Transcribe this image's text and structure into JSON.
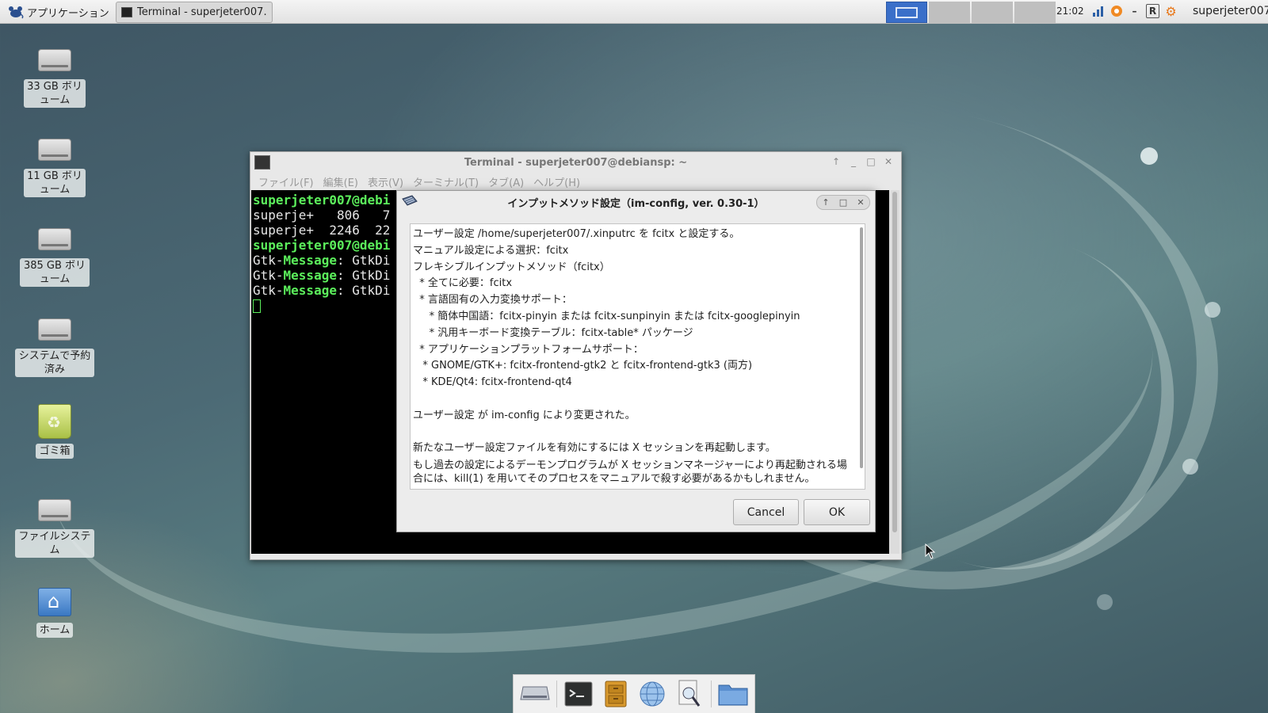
{
  "panel": {
    "apps_menu_label": "アプリケーション",
    "task_button_label": "Terminal - superjeter007…",
    "clock": "21:02",
    "user": "superjeter007",
    "tray_letter": "R"
  },
  "desktop": {
    "icons": [
      {
        "label": "33 GB ボリューム"
      },
      {
        "label": "11 GB ボリューム"
      },
      {
        "label": "385 GB ボリューム"
      },
      {
        "label": "システムで予約済み"
      },
      {
        "label": "ゴミ箱"
      },
      {
        "label": "ファイルシステム"
      },
      {
        "label": "ホーム"
      }
    ]
  },
  "terminal": {
    "title": "Terminal - superjeter007@debiansp: ~",
    "menu": [
      "ファイル(F)",
      "編集(E)",
      "表示(V)",
      "ターミナル(T)",
      "タブ(A)",
      "ヘルプ(H)"
    ],
    "lines": [
      {
        "prefix": "superjeter007@debi",
        "rest": ""
      },
      {
        "prefix": "",
        "rest": "superje+   806   7"
      },
      {
        "prefix": "",
        "rest": "superje+  2246  22"
      },
      {
        "prefix": "superjeter007@debi",
        "rest": ""
      },
      {
        "prefix": "Gtk-",
        "mid": "Message",
        "rest": ": GtkDi"
      },
      {
        "prefix": "Gtk-",
        "mid": "Message",
        "rest": ": GtkDi"
      },
      {
        "prefix": "Gtk-",
        "mid": "Message",
        "rest": ": GtkDi"
      }
    ]
  },
  "dialog": {
    "title": "インプットメソッド設定（im-config, ver. 0.30-1）",
    "lines": [
      "ユーザー設定 /home/superjeter007/.xinputrc を fcitx と設定する。",
      "マニュアル設定による選択：fcitx",
      "フレキシブルインプットメソッド（fcitx）",
      "  * 全てに必要：fcitx",
      "  * 言語固有の入力変換サポート：",
      "     * 簡体中国語：fcitx-pinyin または fcitx-sunpinyin または fcitx-googlepinyin",
      "     * 汎用キーボード変換テーブル：fcitx-table* パッケージ",
      "  * アプリケーションプラットフォームサポート：",
      "   * GNOME/GTK+: fcitx-frontend-gtk2 と fcitx-frontend-gtk3 (両方)",
      "   * KDE/Qt4: fcitx-frontend-qt4",
      "",
      "ユーザー設定 が im-config により変更された。",
      "",
      "新たなユーザー設定ファイルを有効にするには X セッションを再起動します。",
      "もし過去の設定によるデーモンプログラムが X セッションマネージャーにより再起動される場合には、kill(1) を用いてそのプロセスをマニュアルで殺す必要があるかもしれません。"
    ],
    "cancel_label": "Cancel",
    "ok_label": "OK"
  },
  "dock": {
    "items": [
      "drive-icon",
      "terminal-icon",
      "file-cabinet-icon",
      "web-browser-icon",
      "search-icon",
      "folder-icon"
    ]
  }
}
